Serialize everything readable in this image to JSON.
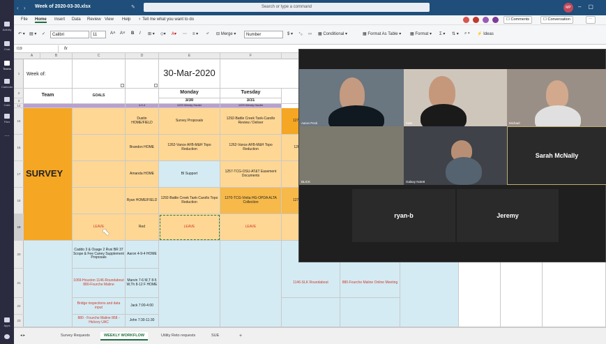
{
  "titlebar": {
    "doc_title": "Week of 2020-03-30.xlsx",
    "search_placeholder": "Search or type a command",
    "avatar_initials": "MP"
  },
  "rail": [
    {
      "label": "Activity"
    },
    {
      "label": "Chat"
    },
    {
      "label": "Teams"
    },
    {
      "label": "Calendar"
    },
    {
      "label": "Calls"
    },
    {
      "label": "Files"
    },
    {
      "label": "..."
    },
    {
      "label": "Apps"
    },
    {
      "label": "Help"
    }
  ],
  "menu": [
    "File",
    "Home",
    "Insert",
    "Data",
    "Review",
    "View",
    "Help"
  ],
  "tell_me": "Tell me what you want to do",
  "toolbar": {
    "font": "Calibri",
    "size": "11",
    "number_format": "Number",
    "merge": "Merge",
    "conditional": "Conditional",
    "format_table": "Format As Table",
    "format": "Format",
    "ideas": "Ideas",
    "comments": "Comments",
    "conversation": "Conversation"
  },
  "namebox": "I19",
  "fx": "fx",
  "columns": [
    "A",
    "B",
    "C",
    "D",
    "E",
    "F"
  ],
  "rows": [
    "1",
    "2",
    "3",
    "14",
    "15",
    "16",
    "17",
    "18",
    "19",
    "20",
    "21",
    "22",
    "23"
  ],
  "header": {
    "week_of": "Week of:",
    "date": "30-Mar-2020",
    "team": "Team",
    "goals": "GOALS",
    "monday": "Monday",
    "monday_date": "3/30",
    "tuesday": "Tuesday",
    "tuesday_date": "3/31",
    "partial_row": "4-9-4",
    "partial_e": "1229 Wendy Hauler",
    "partial_f": "1229 Wendy Hauler"
  },
  "survey_label": "SURVEY",
  "survey_rows": [
    {
      "name": "Dustin HOME/FIELD",
      "mon": "Survey Proposals",
      "tue": "1292-Battle Creek Tank-Carollo Review / Deliver",
      "wed": "1270"
    },
    {
      "name": "Brandon HOME",
      "mon": "1262-Vance AFB-M&H Topo Reduction",
      "tue": "1262-Vance AFB-M&H Topo Reduction",
      "wed": "126"
    },
    {
      "name": "Amanda HOME",
      "mon": "BI Support",
      "tue": "1257-TCG-OSU-AT&T Easement Documents",
      "wed": ""
    },
    {
      "name": "Ryan HOME/FIELD",
      "mon": "1292-Battle Creek Tank-Carollo Topo Reduction",
      "tue": "1270-TCG-Vinita HG-OPDA ALTA Collection",
      "wed": "1270"
    },
    {
      "name": "Red",
      "goal": "LEAVE",
      "mon": "LEAVE",
      "tue": "LEAVE"
    }
  ],
  "lower_rows": [
    {
      "goal": "Caddo 3 & Osage 2 Rvsi BR 37 Scope & Fee Caney Supplement Proposals",
      "name": "Aaron 4-9-4 HOME"
    },
    {
      "goal": "1069-Houston 1146-Roundabout 880-Fourche Maline",
      "name": "Marvin 7-6 M,T 8-5 W,Th 8-12 F HOME",
      "h": "1146-SLK Roundabout",
      "i": "880-Fourche Maline Online Meeting"
    },
    {
      "goal": "Bridge inspections and data input",
      "name": "Jack 7:00-4:00"
    },
    {
      "goal": "880 - Fourche Maline 868 - Hickory UAC",
      "name": "John 7:30-11:30"
    }
  ],
  "sheet_tabs": [
    "Survey Requests",
    "WEEKLY WORKFLOW",
    "Utility Reto requests",
    "SUE",
    "+"
  ],
  "video": {
    "participants": [
      "Aaron Peck",
      "Kate",
      "Michael",
      "BLICK",
      "Galaxy Note8",
      "Sarah McNally",
      "ryan-b",
      "Jeremy"
    ]
  }
}
